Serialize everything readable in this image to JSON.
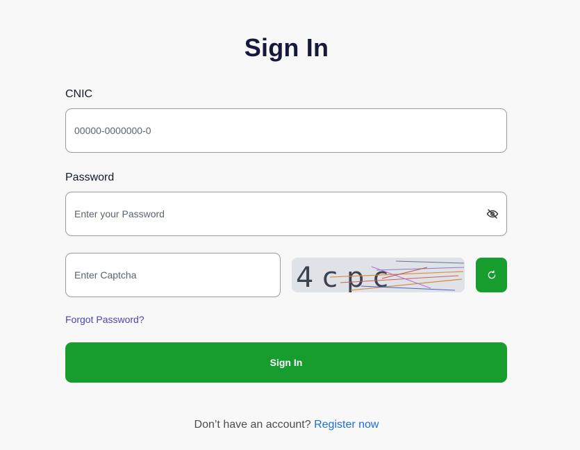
{
  "page": {
    "title": "Sign In"
  },
  "form": {
    "cnic_label": "CNIC",
    "cnic_placeholder": "00000-0000000-0",
    "password_label": "Password",
    "password_placeholder": "Enter your Password",
    "captcha_placeholder": "Enter Captcha",
    "captcha_text": "4 c p c",
    "forgot_password": "Forgot Password?",
    "submit_label": "Sign In"
  },
  "footer": {
    "prompt": "Don’t have an account?",
    "register_link": "Register now"
  },
  "colors": {
    "primary_green": "#179c2e",
    "link_purple": "#4b44b8",
    "link_blue": "#1f6fd1",
    "title": "#16193a",
    "background": "#f8f8f8"
  },
  "icons": {
    "password_toggle": "eye-off-icon",
    "captcha_refresh": "refresh-icon"
  }
}
